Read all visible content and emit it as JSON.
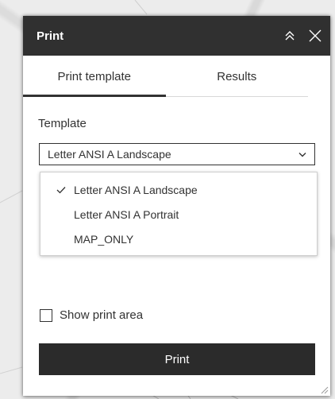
{
  "window": {
    "title": "Print",
    "collapse_icon": "double-chevron-up-icon",
    "close_icon": "close-icon"
  },
  "tabs": [
    {
      "label": "Print template",
      "active": true
    },
    {
      "label": "Results",
      "active": false
    }
  ],
  "template": {
    "label": "Template",
    "selected": "Letter ANSI A Landscape",
    "options": [
      {
        "label": "Letter ANSI A Landscape",
        "selected": true
      },
      {
        "label": "Letter ANSI A Portrait",
        "selected": false
      },
      {
        "label": "MAP_ONLY",
        "selected": false
      }
    ]
  },
  "show_print_area": {
    "label": "Show print area",
    "checked": false
  },
  "print_button": {
    "label": "Print"
  },
  "colors": {
    "titlebar": "#303030",
    "button": "#2b2b2b",
    "text": "#323232"
  }
}
